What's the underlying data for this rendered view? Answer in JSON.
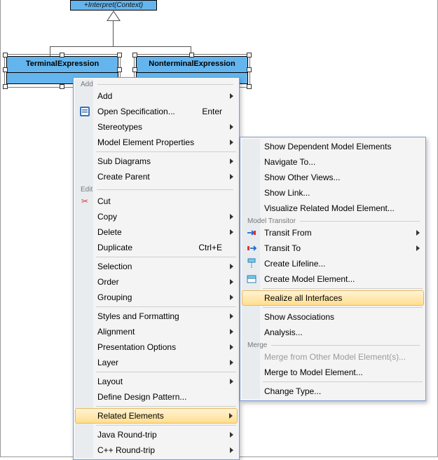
{
  "uml": {
    "parent_method": "+Interpret(Context)",
    "terminal_label": "TerminalExpression",
    "nonterminal_label": "NonterminalExpression"
  },
  "menu1": {
    "sections": {
      "add": "Add",
      "edit": "Edit"
    },
    "items": {
      "add": "Add",
      "open_spec": "Open Specification...",
      "open_spec_shortcut": "Enter",
      "stereotypes": "Stereotypes",
      "model_props": "Model Element Properties",
      "sub_diagrams": "Sub Diagrams",
      "create_parent": "Create Parent",
      "cut": "Cut",
      "copy": "Copy",
      "delete": "Delete",
      "duplicate": "Duplicate",
      "duplicate_shortcut": "Ctrl+E",
      "selection": "Selection",
      "order": "Order",
      "grouping": "Grouping",
      "styles": "Styles and Formatting",
      "alignment": "Alignment",
      "presentation": "Presentation Options",
      "layer": "Layer",
      "layout": "Layout",
      "define_pattern": "Define Design Pattern...",
      "related": "Related Elements",
      "java_rt": "Java Round-trip",
      "cpp_rt": "C++ Round-trip"
    }
  },
  "menu2": {
    "sections": {
      "transitor": "Model Transitor",
      "merge": "Merge"
    },
    "items": {
      "show_dependent": "Show Dependent Model Elements",
      "navigate_to": "Navigate To...",
      "show_other_views": "Show Other Views...",
      "show_link": "Show Link...",
      "visualize_related": "Visualize Related Model Element...",
      "transit_from": "Transit From",
      "transit_to": "Transit To",
      "create_lifeline": "Create Lifeline...",
      "create_model_el": "Create Model Element...",
      "realize_all": "Realize all Interfaces",
      "show_assoc": "Show Associations",
      "analysis": "Analysis...",
      "merge_from": "Merge from Other Model Element(s)...",
      "merge_to": "Merge to Model Element...",
      "change_type": "Change Type..."
    }
  }
}
